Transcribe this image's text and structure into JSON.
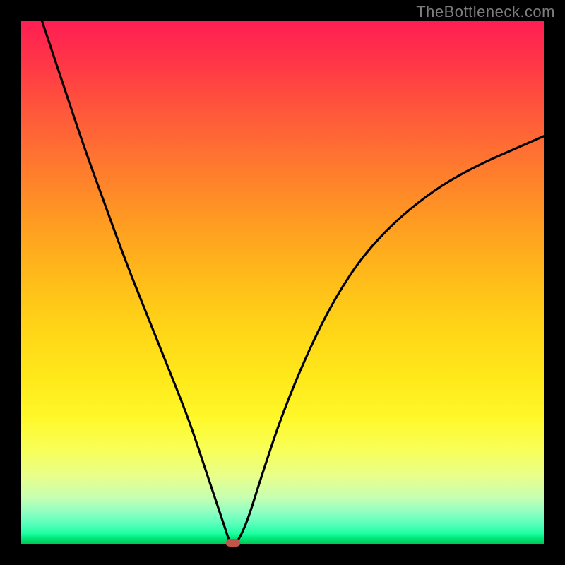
{
  "watermark": "TheBottleneck.com",
  "chart_data": {
    "type": "line",
    "title": "",
    "xlabel": "",
    "ylabel": "",
    "xlim": [
      0,
      100
    ],
    "ylim": [
      0,
      100
    ],
    "grid": false,
    "series": [
      {
        "name": "curve",
        "x": [
          4,
          8,
          12,
          16,
          20,
          24,
          28,
          32,
          35,
          37,
          38.5,
          39.5,
          40,
          41,
          42,
          43.5,
          46,
          50,
          55,
          60,
          66,
          74,
          84,
          100
        ],
        "y": [
          100,
          88,
          76,
          65,
          54,
          44,
          34,
          24,
          15,
          9,
          4.5,
          1.5,
          0,
          0,
          1.5,
          5,
          13,
          25,
          37,
          47,
          56,
          64,
          71,
          78
        ]
      }
    ],
    "marker": {
      "x": 40.5,
      "y": 0,
      "color": "#c1554b"
    },
    "background_gradient": {
      "stops": [
        {
          "pos": 0.0,
          "color": "#ff1e53"
        },
        {
          "pos": 0.5,
          "color": "#ffd317"
        },
        {
          "pos": 0.82,
          "color": "#f8ff58"
        },
        {
          "pos": 1.0,
          "color": "#00c853"
        }
      ]
    }
  }
}
